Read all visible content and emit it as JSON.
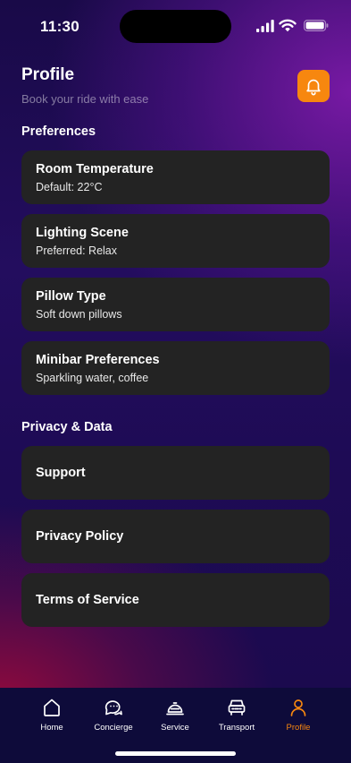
{
  "status": {
    "time": "11:30"
  },
  "header": {
    "title": "Profile",
    "subtitle": "Book your ride with ease"
  },
  "icons": {
    "notification": "bell-icon"
  },
  "colors": {
    "accent": "#f7870f",
    "card": "#232323",
    "tab_bar": "#0e0b3a"
  },
  "preferences": {
    "title": "Preferences",
    "items": [
      {
        "title": "Room Temperature",
        "subtitle": "Default: 22°C"
      },
      {
        "title": "Lighting Scene",
        "subtitle": "Preferred: Relax"
      },
      {
        "title": "Pillow Type",
        "subtitle": "Soft down pillows"
      },
      {
        "title": "Minibar Preferences",
        "subtitle": "Sparkling water, coffee"
      }
    ]
  },
  "privacy": {
    "title": "Privacy & Data",
    "items": [
      {
        "title": "Support"
      },
      {
        "title": "Privacy Policy"
      },
      {
        "title": "Terms of Service"
      }
    ]
  },
  "tabs": [
    {
      "label": "Home",
      "icon": "home-icon"
    },
    {
      "label": "Concierge",
      "icon": "chat-icon"
    },
    {
      "label": "Service",
      "icon": "bell-service-icon"
    },
    {
      "label": "Transport",
      "icon": "car-icon"
    },
    {
      "label": "Profile",
      "icon": "user-icon",
      "active": true
    }
  ]
}
